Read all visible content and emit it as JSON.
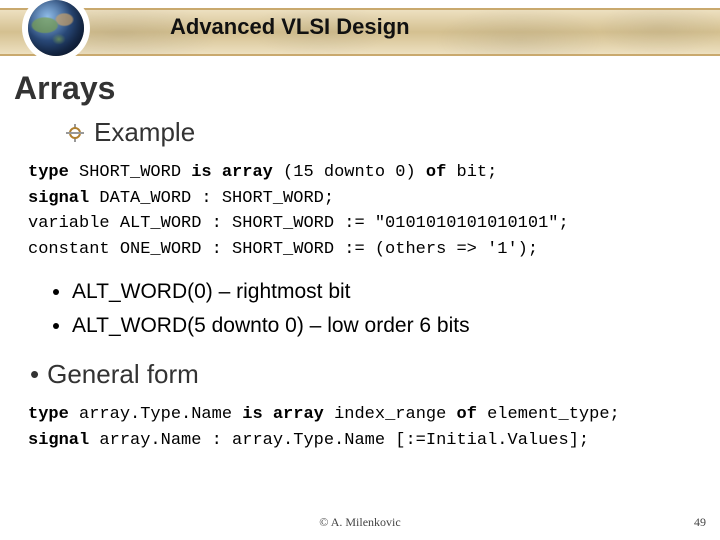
{
  "header": {
    "title": "Advanced VLSI Design"
  },
  "slide": {
    "title": "Arrays",
    "subhead": "Example"
  },
  "code_example": {
    "l1_kw1": "type",
    "l1_mid": " SHORT_WORD ",
    "l1_kw2": "is array",
    "l1_tail": " (15 downto 0) ",
    "l1_kw3": "of",
    "l1_end": " bit;",
    "l2_kw": "signal",
    "l2_tail": " DATA_WORD : SHORT_WORD;",
    "l3": "variable ALT_WORD : SHORT_WORD := \"0101010101010101\";",
    "l4": "constant ONE_WORD : SHORT_WORD := (others => '1');"
  },
  "bullets": [
    "ALT_WORD(0) – rightmost bit",
    "ALT_WORD(5 downto 0) – low order 6 bits"
  ],
  "general": {
    "label": "General form"
  },
  "code_general": {
    "l1_kw1": "type",
    "l1_mid": " array.Type.Name ",
    "l1_kw2": "is array",
    "l1_mid2": " index_range ",
    "l1_kw3": "of",
    "l1_end": " element_type;",
    "l2_kw": "signal",
    "l2_tail": " array.Name : array.Type.Name [:=Initial.Values];"
  },
  "footer": {
    "center": "© A. Milenkovic",
    "page": "49"
  }
}
